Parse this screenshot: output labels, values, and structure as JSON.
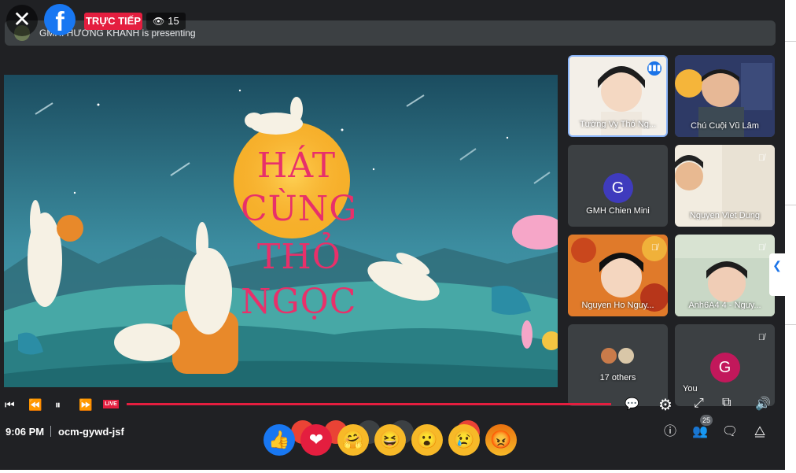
{
  "stream": {
    "live_label": "TRỰC TIẾP",
    "viewer_count": "15",
    "presenting_text": "GMH. HƯƠNG KHÁNH is presenting"
  },
  "slide": {
    "title_lines": [
      "HÁT",
      "CÙNG",
      "THỎ",
      "NGỌC"
    ]
  },
  "participants": [
    {
      "name": "Tường Vy Thỏ Ng...",
      "speaking": true
    },
    {
      "name": "Chú Cuội Vũ Lâm",
      "speaking": false
    },
    {
      "name": "GMH Chien Mini",
      "avatar_letter": "G",
      "avatar_color": "#3f3bbd"
    },
    {
      "name": "Nguyen Viet Dung",
      "muted": true
    },
    {
      "name": "Nguyen Ho Nguy...",
      "muted": true
    },
    {
      "name": "Anh6A4 4 - Nguy...",
      "muted": true
    },
    {
      "name": "17 others"
    },
    {
      "name": "You",
      "avatar_letter": "G",
      "avatar_color": "#c2185b",
      "muted": true
    }
  ],
  "player": {
    "live_tag": "LIVE",
    "progress": 1.0
  },
  "meeting": {
    "time": "9:06 PM",
    "code": "ocm-gywd-jsf",
    "people_count": "25"
  },
  "reactions": [
    "like",
    "love",
    "care",
    "haha",
    "wow",
    "sad",
    "angry"
  ],
  "colors": {
    "live_red": "#e41e3f",
    "facebook_blue": "#1877f2",
    "meet_bg": "#202124",
    "tile_bg": "#3c4043"
  }
}
